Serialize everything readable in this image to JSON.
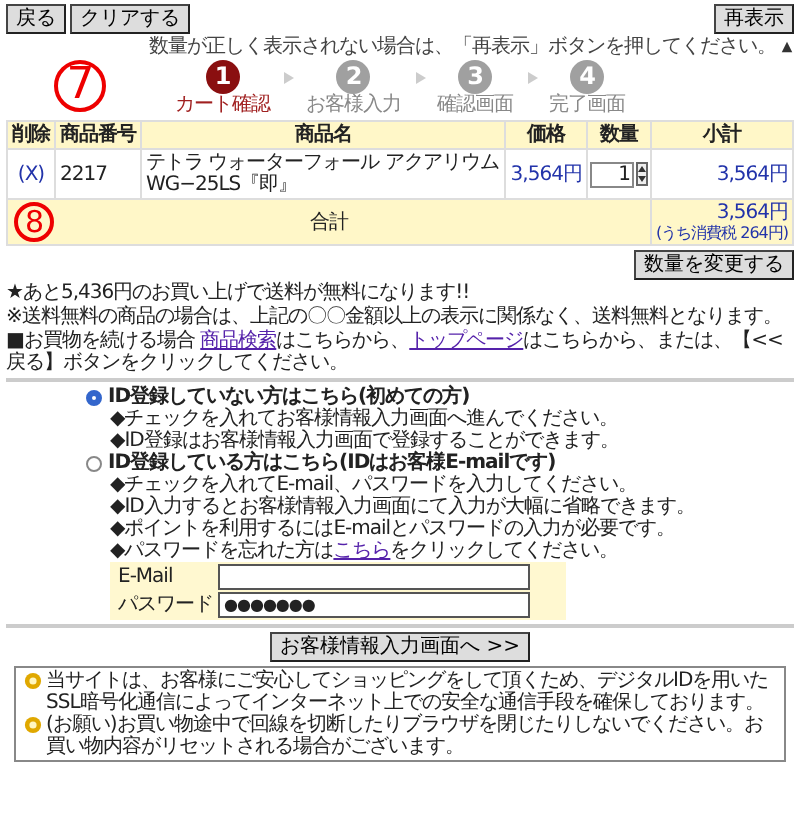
{
  "top_buttons": [
    {
      "label": "戻る"
    },
    {
      "label": "クリアする"
    }
  ],
  "refresh_button": "再表示",
  "notice": "数量が正しく表示されない場合は、「再表示」ボタンを押してください。",
  "annotations": [
    {
      "label": "7"
    },
    {
      "label": "8"
    }
  ],
  "steps": [
    {
      "number": "1",
      "label": "カート確認",
      "selected": true
    },
    {
      "number": "2",
      "label": "お客様入力",
      "selected": false
    },
    {
      "number": "3",
      "label": "確認画面",
      "selected": false
    },
    {
      "number": "4",
      "label": "完了画面",
      "selected": false
    }
  ],
  "cart": {
    "columns": [
      "削除",
      "商品番号",
      "商品名",
      "価格",
      "数量",
      "小計"
    ],
    "rows": [
      {
        "delete": "(X)",
        "code": "2217",
        "name": "テトラ ウォーターフォール アクアリウム WG−25LS『即』",
        "price": "3,564円",
        "quantity": "1",
        "subtotal": "3,564円"
      }
    ],
    "total_label": "合計",
    "total": "3,564円",
    "tax": "(うち消費税 264円)"
  },
  "change_button": "数量を変更する",
  "notes": [
    {
      "kind": "plain",
      "text": "★あと5,436円のお買い上げで送料が無料になります!!"
    },
    {
      "kind": "plain",
      "text": "※送料無料の商品の場合は、上記の〇〇金額以上の表示に関係なく、送料無料となります。"
    },
    {
      "kind": "links",
      "parts": [
        "■お買物を続ける場合 ",
        "商品検索",
        "はこちらから、",
        "トップページ",
        "はこちらから、または、【<<戻る】ボタンをクリックしてください。"
      ]
    }
  ],
  "login_options": [
    {
      "label": "ID登録していない方はこちら(初めての方)",
      "selected": true,
      "bullets": [
        "◆チェックを入れてお客様情報入力画面へ進んでください。",
        "◆ID登録はお客様情報入力画面で登録することができます。"
      ]
    },
    {
      "label": "ID登録している方はこちら(IDはお客様E-mailです)",
      "selected": false,
      "bullets": [
        "◆チェックを入れてE-mail、パスワードを入力してください。",
        "◆ID入力するとお客様情報入力画面にて入力が大幅に省略できます。",
        "◆ポイントを利用するにはE-mailとパスワードの入力が必要です。"
      ],
      "forgot": [
        "◆パスワードを忘れた方は",
        "こちら",
        "をクリックしてください。"
      ]
    }
  ],
  "login_form": [
    {
      "label": "E-Mail"
    },
    {
      "label": "パスワード",
      "value": "●●●●●●●"
    }
  ],
  "submit_button": "お客様情報入力画面へ >>",
  "security_notes": [
    "当サイトは、お客様にご安心してショッピングをして頂くため、デジタルIDを用いたSSL暗号化通信によってインターネット上での安全な通信手段を確保しております。",
    "(お願い)お買い物途中で回線を切断したりブラウザを閉じたりしないでください。お買い物内容がリセットされる場合がございます。"
  ]
}
